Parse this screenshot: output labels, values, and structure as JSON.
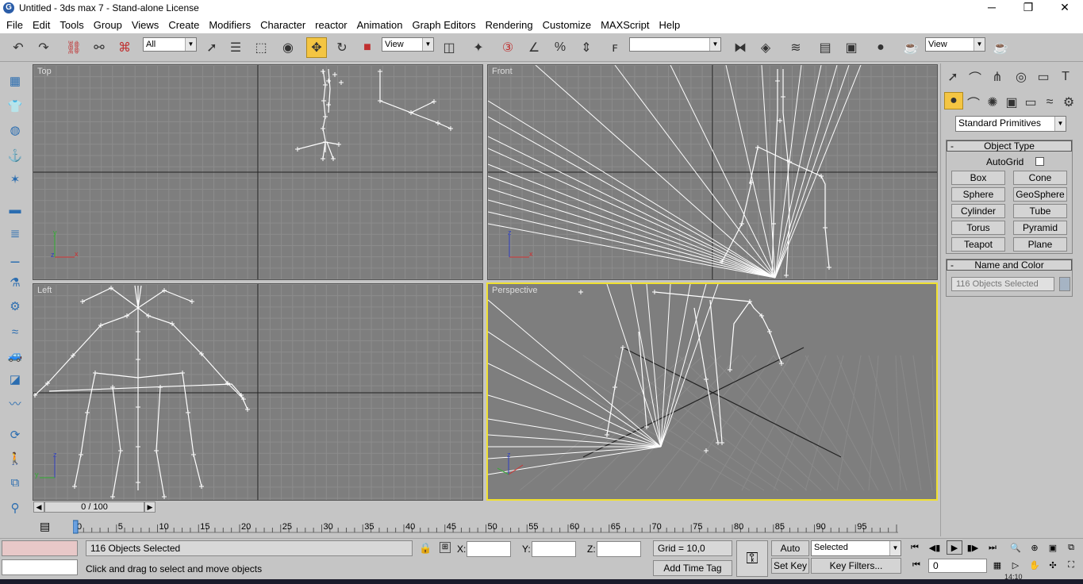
{
  "window": {
    "title": "Untitled - 3ds max 7 - Stand-alone License",
    "app_icon": "G",
    "minimize": "─",
    "maximize": "❐",
    "close": "✕"
  },
  "menu": [
    "File",
    "Edit",
    "Tools",
    "Group",
    "Views",
    "Create",
    "Modifiers",
    "Character",
    "reactor",
    "Animation",
    "Graph Editors",
    "Rendering",
    "Customize",
    "MAXScript",
    "Help"
  ],
  "toolbar": {
    "selection_filter": "All",
    "ref_coord_left": "View",
    "named_selection": "",
    "ref_coord_right": "View"
  },
  "viewports": {
    "top": "Top",
    "front": "Front",
    "left": "Left",
    "perspective": "Perspective",
    "axis_x": "x",
    "axis_y": "y",
    "axis_z": "z"
  },
  "time_slider": {
    "label": "0 / 100",
    "current": 0,
    "max": 100,
    "ticks": [
      "0",
      "5",
      "10",
      "15",
      "20",
      "25",
      "30",
      "35",
      "40",
      "45",
      "50",
      "55",
      "60",
      "65",
      "70",
      "75",
      "80",
      "85",
      "90",
      "95",
      "100"
    ]
  },
  "command_panel": {
    "category": "Standard Primitives",
    "object_type_title": "Object Type",
    "autogrid_label": "AutoGrid",
    "autogrid_checked": false,
    "buttons": [
      "Box",
      "Cone",
      "Sphere",
      "GeoSphere",
      "Cylinder",
      "Tube",
      "Torus",
      "Pyramid",
      "Teapot",
      "Plane"
    ],
    "name_color_title": "Name and Color",
    "name_field": "116 Objects Selected",
    "rollout_toggle": "-"
  },
  "status": {
    "selection_count": "116 Objects Selected",
    "prompt": "Click and drag to select and move objects",
    "x_label": "X:",
    "y_label": "Y:",
    "z_label": "Z:",
    "x_value": "",
    "y_value": "",
    "z_value": "",
    "grid": "Grid = 10,0",
    "add_time_tag": "Add Time Tag",
    "auto_key": "Auto Key",
    "set_key": "Set Key",
    "key_mode": "Selected",
    "key_filters": "Key Filters...",
    "frame": "0"
  },
  "taskbar": {
    "clock": "14:10"
  },
  "colors": {
    "viewport_bg": "#7e7e7e",
    "active_border": "#f0e030",
    "move_tool_active": "#f4c542",
    "wire": "#ffffff"
  }
}
